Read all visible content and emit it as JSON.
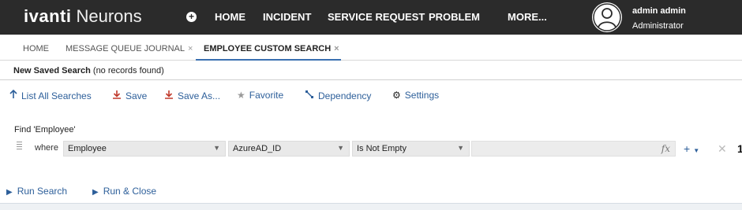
{
  "app": {
    "brand": "ivanti",
    "product": "Neurons"
  },
  "nav": {
    "items": [
      "HOME",
      "INCIDENT",
      "SERVICE REQUEST",
      "PROBLEM",
      "MORE..."
    ],
    "add_icon": "plus-circle-icon"
  },
  "user": {
    "name": "admin admin",
    "role": "Administrator",
    "avatar_icon": "user-avatar-icon"
  },
  "tabs": [
    {
      "label": "HOME",
      "closable": false,
      "active": false
    },
    {
      "label": "MESSAGE QUEUE JOURNAL",
      "closable": true,
      "active": false
    },
    {
      "label": "EMPLOYEE CUSTOM SEARCH",
      "closable": true,
      "active": true
    }
  ],
  "tab_close_glyph": "×",
  "search": {
    "title": "New Saved Search",
    "status": "(no records found)"
  },
  "toolbar": {
    "list_all": "List All Searches",
    "save": "Save",
    "save_as": "Save As...",
    "favorite": "Favorite",
    "dependency": "Dependency",
    "settings": "Settings"
  },
  "criteria": {
    "find_label": "Find 'Employee'",
    "where_label": "where",
    "object": "Employee",
    "field": "AzureAD_ID",
    "operator": "Is Not Empty",
    "value": "",
    "fx": "fx",
    "trailing_char": "1"
  },
  "actions": {
    "run_search": "Run Search",
    "run_close": "Run & Close"
  },
  "colors": {
    "topbar": "#2b2b2b",
    "link": "#2d5f9a",
    "save_red": "#c0392b",
    "active_underline": "#3a6fb0"
  }
}
